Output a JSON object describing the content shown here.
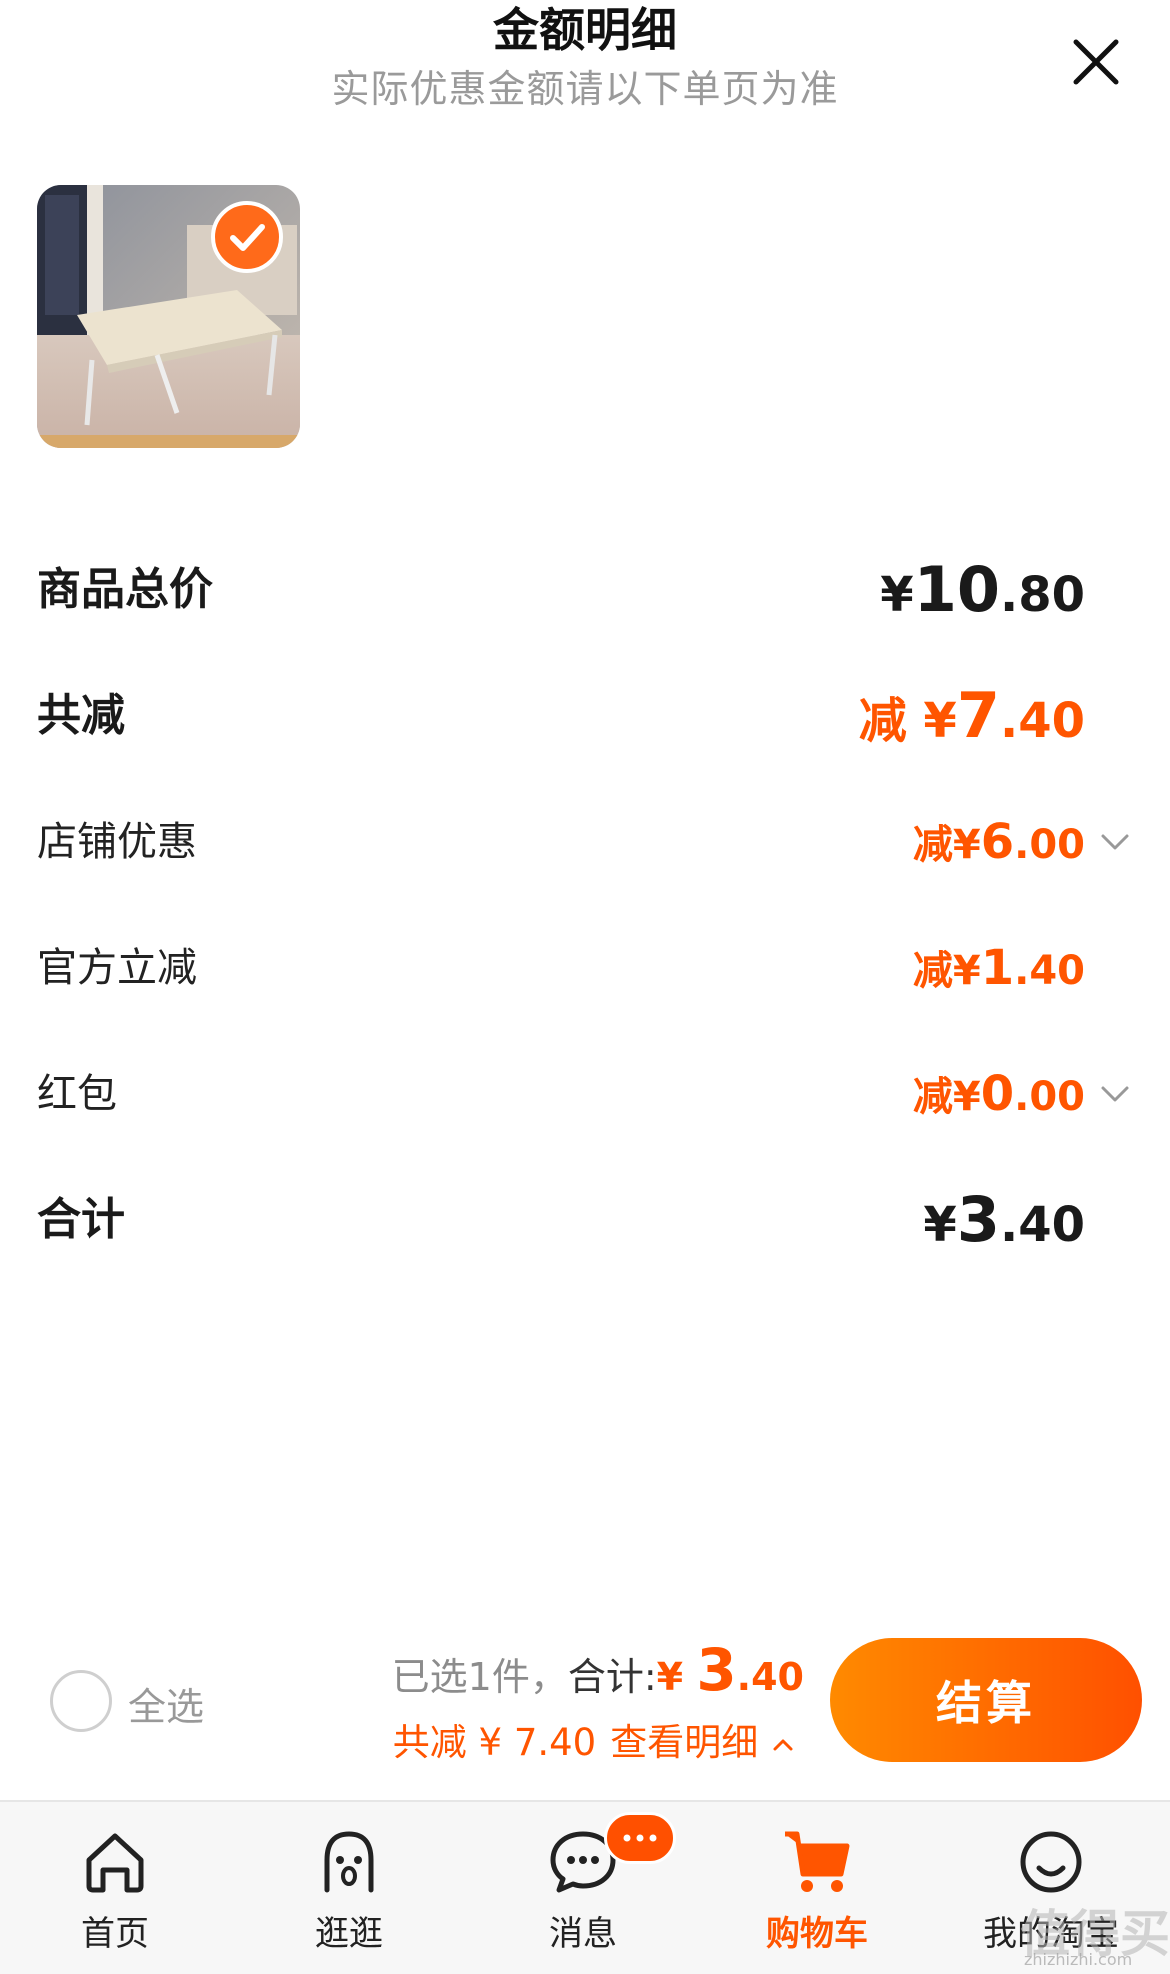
{
  "header": {
    "title": "金额明细",
    "subtitle": "实际优惠金额请以下单页为准"
  },
  "product": {
    "image_icon": "folding-laptop-table-photo",
    "selected": true
  },
  "breakdown": {
    "total": {
      "label": "商品总价",
      "currency": "¥",
      "int": "10",
      "dec": ".80"
    },
    "discount": {
      "label": "共减",
      "prefix": "减 ",
      "currency": "¥",
      "int": "7",
      "dec": ".40"
    },
    "shop": {
      "label": "店铺优惠",
      "prefix": "减",
      "currency": "¥",
      "int": "6",
      "dec": ".00"
    },
    "official": {
      "label": "官方立减",
      "prefix": "减",
      "currency": "¥",
      "int": "1",
      "dec": ".40"
    },
    "redpacket": {
      "label": "红包",
      "prefix": "减",
      "currency": "¥",
      "int": "0",
      "dec": ".00"
    },
    "sum": {
      "label": "合计",
      "currency": "¥",
      "int": "3",
      "dec": ".40"
    }
  },
  "checkout": {
    "select_all": "全选",
    "selected_text": "已选1件，",
    "sum_label": "合计:",
    "currency": "¥ ",
    "sum_int": "3",
    "sum_dec": ".40",
    "discount_text": "共减 ¥ 7.40",
    "detail_link": "查看明细",
    "button": "结算"
  },
  "tabs": [
    {
      "label": "首页",
      "icon": "home-icon"
    },
    {
      "label": "逛逛",
      "icon": "browse-face-icon"
    },
    {
      "label": "消息",
      "icon": "message-icon"
    },
    {
      "label": "购物车",
      "icon": "cart-icon"
    },
    {
      "label": "我的淘宝",
      "icon": "profile-smile-icon"
    }
  ],
  "active_tab": "购物车",
  "watermark": {
    "text": "值得买",
    "url": "zhizhizhi.com"
  },
  "colors": {
    "accent": "#ff5500",
    "accent_gradient_start": "#ff8a00",
    "text": "#1a1a1a",
    "muted": "#9a9a9a"
  }
}
